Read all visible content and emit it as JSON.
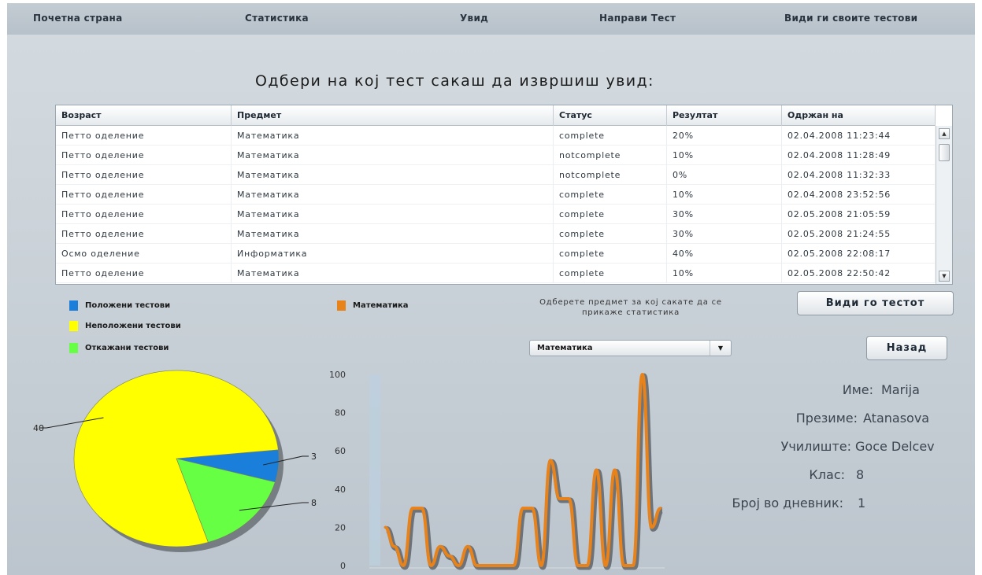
{
  "nav": {
    "items": [
      "Почетна страна",
      "Статистика",
      "Увид",
      "Направи Тест",
      "Види ги своите тестови"
    ]
  },
  "heading": "Одбери на кој тест сакаш да извршиш увид:",
  "table": {
    "columns": [
      "Возраст",
      "Предмет",
      "Статус",
      "Резултат",
      "Одржан на"
    ],
    "rows": [
      [
        "Петто оделение",
        "Математика",
        "complete",
        "20%",
        "02.04.2008 11:23:44"
      ],
      [
        "Петто оделение",
        "Математика",
        "notcomplete",
        "10%",
        "02.04.2008 11:28:49"
      ],
      [
        "Петто оделение",
        "Математика",
        "notcomplete",
        "0%",
        "02.04.2008 11:32:33"
      ],
      [
        "Петто оделение",
        "Математика",
        "complete",
        "10%",
        "02.04.2008 23:52:56"
      ],
      [
        "Петто оделение",
        "Математика",
        "complete",
        "30%",
        "02.05.2008 21:05:59"
      ],
      [
        "Петто оделение",
        "Математика",
        "complete",
        "30%",
        "02.05.2008 21:24:55"
      ],
      [
        "Осмо оделение",
        "Информатика",
        "complete",
        "40%",
        "02.05.2008 22:08:17"
      ],
      [
        "Петто оделение",
        "Математика",
        "complete",
        "10%",
        "02.05.2008 22:50:42"
      ]
    ]
  },
  "legend": {
    "items": [
      {
        "label": "Положени тестови",
        "color": "#1a7fdb"
      },
      {
        "label": "Неположени тестови",
        "color": "#ffff00"
      },
      {
        "label": "Откажани тестови",
        "color": "#66ff44"
      }
    ],
    "subject": {
      "label": "Математика",
      "color": "#e8821a"
    }
  },
  "selector": {
    "caption": "Одберете предмет за кој сакате да се прикаже статистика",
    "value": "Математика"
  },
  "buttons": {
    "view_test": "Види го тестот",
    "back": "Назад"
  },
  "student": {
    "name_label": "Име:",
    "name": "Marija",
    "surname_label": "Презиме:",
    "surname": "Atanasova",
    "school_label": "Училиште:",
    "school": "Goce Delcev",
    "class_label": "Клас:",
    "class": "8",
    "journal_label": "Број во дневник:",
    "journal": "1"
  },
  "chart_data": [
    {
      "type": "pie",
      "slices": [
        {
          "label": "3",
          "value": 3,
          "color": "#1a7fdb"
        },
        {
          "label": "8",
          "value": 8,
          "color": "#66ff44"
        },
        {
          "label": "40",
          "value": 40,
          "color": "#ffff00"
        }
      ]
    },
    {
      "type": "line",
      "ylim": [
        0,
        100
      ],
      "yticks": [
        0,
        20,
        40,
        60,
        80,
        100
      ],
      "series": [
        {
          "name": "Математика",
          "color": "#e8821a",
          "values": [
            20,
            10,
            0,
            30,
            30,
            0,
            10,
            5,
            0,
            10,
            0,
            0,
            0,
            0,
            0,
            30,
            30,
            0,
            55,
            35,
            35,
            0,
            0,
            50,
            0,
            50,
            0,
            0,
            100,
            20,
            30
          ]
        }
      ]
    }
  ]
}
